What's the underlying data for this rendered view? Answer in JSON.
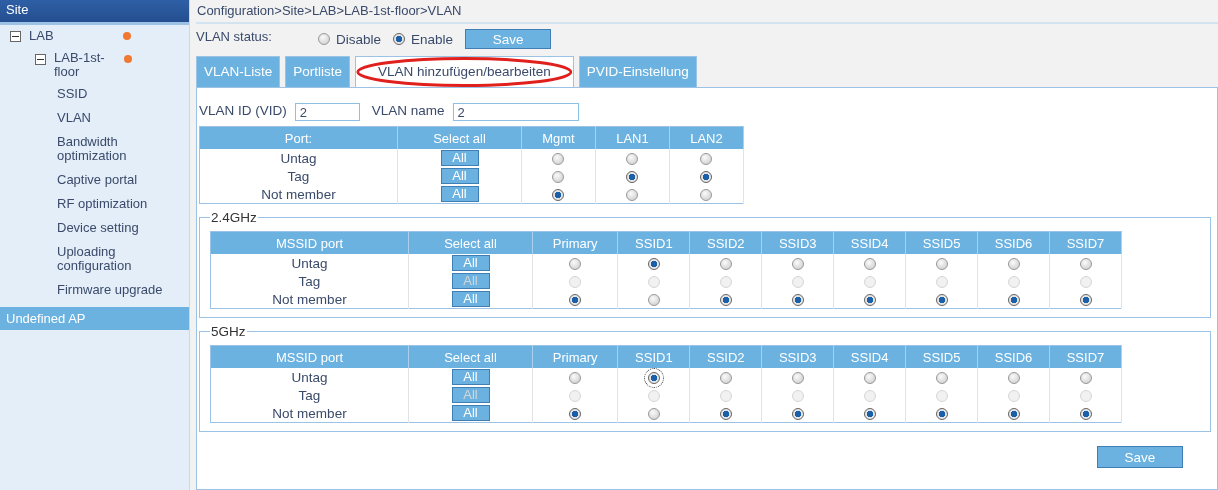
{
  "sidebar": {
    "header": "Site",
    "tree": [
      {
        "label": "LAB",
        "expanded": true,
        "alert": true,
        "children": [
          {
            "label": "LAB-1st-floor",
            "expanded": true,
            "alert": true,
            "children": [
              {
                "label": "SSID"
              },
              {
                "label": "VLAN"
              },
              {
                "label": "Bandwidth optimization"
              },
              {
                "label": "Captive portal"
              },
              {
                "label": "RF optimization"
              },
              {
                "label": "Device setting"
              },
              {
                "label": "Uploading configuration"
              },
              {
                "label": "Firmware upgrade"
              }
            ]
          }
        ]
      }
    ],
    "footer": "Undefined AP"
  },
  "breadcrumb": "Configuration>Site>LAB>LAB-1st-floor>VLAN",
  "vlan_status": {
    "label": "VLAN status:",
    "options": [
      {
        "label": "Disable",
        "selected": false
      },
      {
        "label": "Enable",
        "selected": true
      }
    ],
    "save": "Save"
  },
  "tabs": [
    {
      "label": "VLAN-Liste",
      "selected": false,
      "circled": false
    },
    {
      "label": "Portliste",
      "selected": false,
      "circled": false
    },
    {
      "label": "VLAN hinzufügen/bearbeiten",
      "selected": true,
      "circled": true
    },
    {
      "label": "PVID-Einstellung",
      "selected": false,
      "circled": false
    }
  ],
  "fields": [
    {
      "label": "VLAN ID (VID)",
      "value": "2"
    },
    {
      "label": "VLAN name",
      "value": "2"
    }
  ],
  "port_table": {
    "columns": [
      "Port:",
      "Select all",
      "Mgmt",
      "LAN1",
      "LAN2"
    ],
    "rows": [
      {
        "label": "Untag",
        "button": "All",
        "disabled": false,
        "radios": [
          {
            "selected": false
          },
          {
            "selected": false
          },
          {
            "selected": false
          }
        ]
      },
      {
        "label": "Tag",
        "button": "All",
        "disabled": false,
        "radios": [
          {
            "selected": false
          },
          {
            "selected": true
          },
          {
            "selected": true
          }
        ]
      },
      {
        "label": "Not member",
        "button": "All",
        "disabled": false,
        "radios": [
          {
            "selected": true
          },
          {
            "selected": false
          },
          {
            "selected": false
          }
        ]
      }
    ]
  },
  "bands": [
    {
      "title": "2.4GHz",
      "columns": [
        "MSSID port",
        "Select all",
        "Primary",
        "SSID1",
        "SSID2",
        "SSID3",
        "SSID4",
        "SSID5",
        "SSID6",
        "SSID7"
      ],
      "rows": [
        {
          "label": "Untag",
          "button": "All",
          "disabled": false,
          "radios": [
            {
              "selected": false
            },
            {
              "selected": true
            },
            {
              "selected": false
            },
            {
              "selected": false
            },
            {
              "selected": false
            },
            {
              "selected": false
            },
            {
              "selected": false
            },
            {
              "selected": false
            }
          ]
        },
        {
          "label": "Tag",
          "button": "All",
          "disabled": true,
          "radios": [
            {
              "selected": false
            },
            {
              "selected": false
            },
            {
              "selected": false
            },
            {
              "selected": false
            },
            {
              "selected": false
            },
            {
              "selected": false
            },
            {
              "selected": false
            },
            {
              "selected": false
            }
          ]
        },
        {
          "label": "Not member",
          "button": "All",
          "disabled": false,
          "radios": [
            {
              "selected": true
            },
            {
              "selected": false
            },
            {
              "selected": true
            },
            {
              "selected": true
            },
            {
              "selected": true
            },
            {
              "selected": true
            },
            {
              "selected": true
            },
            {
              "selected": true
            }
          ]
        }
      ]
    },
    {
      "title": "5GHz",
      "columns": [
        "MSSID port",
        "Select all",
        "Primary",
        "SSID1",
        "SSID2",
        "SSID3",
        "SSID4",
        "SSID5",
        "SSID6",
        "SSID7"
      ],
      "rows": [
        {
          "label": "Untag",
          "button": "All",
          "disabled": false,
          "radios": [
            {
              "selected": false
            },
            {
              "selected": true,
              "focused": true
            },
            {
              "selected": false
            },
            {
              "selected": false
            },
            {
              "selected": false
            },
            {
              "selected": false
            },
            {
              "selected": false
            },
            {
              "selected": false
            }
          ]
        },
        {
          "label": "Tag",
          "button": "All",
          "disabled": true,
          "radios": [
            {
              "selected": false
            },
            {
              "selected": false
            },
            {
              "selected": false
            },
            {
              "selected": false
            },
            {
              "selected": false
            },
            {
              "selected": false
            },
            {
              "selected": false
            },
            {
              "selected": false
            }
          ]
        },
        {
          "label": "Not member",
          "button": "All",
          "disabled": false,
          "radios": [
            {
              "selected": true
            },
            {
              "selected": false
            },
            {
              "selected": true
            },
            {
              "selected": true
            },
            {
              "selected": true
            },
            {
              "selected": true
            },
            {
              "selected": true
            },
            {
              "selected": true
            }
          ]
        }
      ]
    }
  ],
  "save": "Save"
}
